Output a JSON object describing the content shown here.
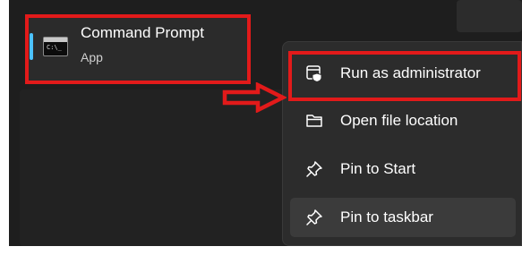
{
  "app": {
    "name": "Command Prompt",
    "type": "App",
    "icon": "cmd-icon",
    "icon_prompt_text": "C:\\_"
  },
  "context_menu": {
    "items": [
      {
        "label": "Run as administrator",
        "icon": "shield-window-icon",
        "highlighted_by_annotation": true
      },
      {
        "label": "Open file location",
        "icon": "folder-icon"
      },
      {
        "label": "Pin to Start",
        "icon": "pin-icon"
      },
      {
        "label": "Pin to taskbar",
        "icon": "pin-icon",
        "hovered": true
      }
    ]
  },
  "annotations": {
    "color": "#e21a1a",
    "arrow_icon": "right-arrow-icon"
  },
  "colors": {
    "accent": "#4cc2ff",
    "menu_background": "#2c2c2c",
    "hover_background": "#3b3b3b",
    "screen_background": "#1e1e1e"
  }
}
